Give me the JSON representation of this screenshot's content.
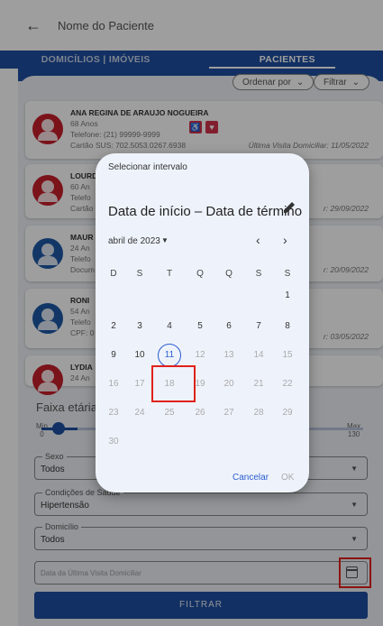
{
  "search": {
    "placeholder": "Nome do Paciente"
  },
  "tabs": [
    {
      "label": "DOMICÍLIOS | IMÓVEIS"
    },
    {
      "label": "PACIENTES"
    }
  ],
  "toolbar": {
    "sort_label": "Ordenar por",
    "filter_label": "Filtrar"
  },
  "patients": [
    {
      "name": "ANA REGINA DE ARAUJO NOGUEIRA",
      "age": "68 Anos",
      "phone": "Telefone: (21) 99999-9999",
      "doc": "Cartão SUS: 702.5053.0267.6938",
      "visit": "Última Visita Domiciliar: 11/05/2022",
      "gender": "f"
    },
    {
      "name": "LOURD",
      "age": "60 An",
      "phone": "Telefo",
      "doc": "Cartão",
      "visit": "r: 29/09/2022",
      "gender": "f"
    },
    {
      "name": "MAUR",
      "age": "24 An",
      "phone": "Telefo",
      "doc": "Docum",
      "visit": "r: 20/09/2022",
      "gender": "m"
    },
    {
      "name": "RONI",
      "age": "54 An",
      "phone": "Telefo",
      "doc": "CPF: 0",
      "visit": "r: 03/05/2022",
      "gender": "m"
    },
    {
      "name": "LYDIA",
      "age": "24 An",
      "phone": "",
      "doc": "",
      "visit": "",
      "gender": "f"
    }
  ],
  "filters": {
    "age_range_label": "Faixa etária",
    "min_label": "Min",
    "min_value": "0",
    "max_label": "Max",
    "max_value": "130",
    "sexo_label": "Sexo",
    "sexo_value": "Todos",
    "condicoes_label": "Condições de Saúde",
    "condicoes_value": "Hipertensão",
    "domicilio_label": "Domicílio",
    "domicilio_value": "Todos",
    "last_visit_placeholder": "Data da Última Visita Domiciliar",
    "filtrar_label": "FILTRAR"
  },
  "dialog": {
    "title": "Selecionar intervalo",
    "headline": "Data de início – Data de término",
    "month_label": "abril de 2023",
    "weekdays": [
      "D",
      "S",
      "T",
      "Q",
      "Q",
      "S",
      "S"
    ],
    "weeks": [
      [
        "",
        "",
        "",
        "",
        "",
        "",
        "1"
      ],
      [
        "2",
        "3",
        "4",
        "5",
        "6",
        "7",
        "8"
      ],
      [
        "9",
        "10",
        "11",
        "12",
        "13",
        "14",
        "15"
      ],
      [
        "16",
        "17",
        "18",
        "19",
        "20",
        "21",
        "22"
      ],
      [
        "23",
        "24",
        "25",
        "26",
        "27",
        "28",
        "29"
      ],
      [
        "30",
        "",
        "",
        "",
        "",
        "",
        ""
      ]
    ],
    "today": "11",
    "cancel_label": "Cancelar",
    "ok_label": "OK"
  },
  "colors": {
    "primary": "#1d4ea0",
    "accent": "#2a5ccf",
    "female_avatar": "#c7202b",
    "male_avatar": "#1d5aa6",
    "highlight_box": "#e0211c"
  },
  "icons": [
    "back-arrow-icon",
    "chevron-down-icon",
    "pencil-icon",
    "chevron-left-icon",
    "chevron-right-icon",
    "calendar-icon",
    "person-icon"
  ]
}
